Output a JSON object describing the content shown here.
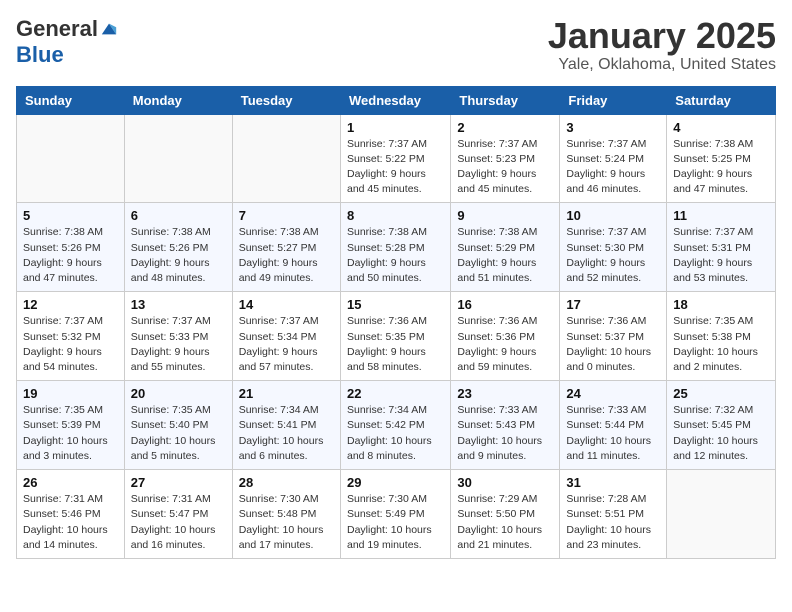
{
  "logo": {
    "general": "General",
    "blue": "Blue"
  },
  "title": "January 2025",
  "location": "Yale, Oklahoma, United States",
  "days_of_week": [
    "Sunday",
    "Monday",
    "Tuesday",
    "Wednesday",
    "Thursday",
    "Friday",
    "Saturday"
  ],
  "weeks": [
    [
      {
        "day": "",
        "info": ""
      },
      {
        "day": "",
        "info": ""
      },
      {
        "day": "",
        "info": ""
      },
      {
        "day": "1",
        "info": "Sunrise: 7:37 AM\nSunset: 5:22 PM\nDaylight: 9 hours\nand 45 minutes."
      },
      {
        "day": "2",
        "info": "Sunrise: 7:37 AM\nSunset: 5:23 PM\nDaylight: 9 hours\nand 45 minutes."
      },
      {
        "day": "3",
        "info": "Sunrise: 7:37 AM\nSunset: 5:24 PM\nDaylight: 9 hours\nand 46 minutes."
      },
      {
        "day": "4",
        "info": "Sunrise: 7:38 AM\nSunset: 5:25 PM\nDaylight: 9 hours\nand 47 minutes."
      }
    ],
    [
      {
        "day": "5",
        "info": "Sunrise: 7:38 AM\nSunset: 5:26 PM\nDaylight: 9 hours\nand 47 minutes."
      },
      {
        "day": "6",
        "info": "Sunrise: 7:38 AM\nSunset: 5:26 PM\nDaylight: 9 hours\nand 48 minutes."
      },
      {
        "day": "7",
        "info": "Sunrise: 7:38 AM\nSunset: 5:27 PM\nDaylight: 9 hours\nand 49 minutes."
      },
      {
        "day": "8",
        "info": "Sunrise: 7:38 AM\nSunset: 5:28 PM\nDaylight: 9 hours\nand 50 minutes."
      },
      {
        "day": "9",
        "info": "Sunrise: 7:38 AM\nSunset: 5:29 PM\nDaylight: 9 hours\nand 51 minutes."
      },
      {
        "day": "10",
        "info": "Sunrise: 7:37 AM\nSunset: 5:30 PM\nDaylight: 9 hours\nand 52 minutes."
      },
      {
        "day": "11",
        "info": "Sunrise: 7:37 AM\nSunset: 5:31 PM\nDaylight: 9 hours\nand 53 minutes."
      }
    ],
    [
      {
        "day": "12",
        "info": "Sunrise: 7:37 AM\nSunset: 5:32 PM\nDaylight: 9 hours\nand 54 minutes."
      },
      {
        "day": "13",
        "info": "Sunrise: 7:37 AM\nSunset: 5:33 PM\nDaylight: 9 hours\nand 55 minutes."
      },
      {
        "day": "14",
        "info": "Sunrise: 7:37 AM\nSunset: 5:34 PM\nDaylight: 9 hours\nand 57 minutes."
      },
      {
        "day": "15",
        "info": "Sunrise: 7:36 AM\nSunset: 5:35 PM\nDaylight: 9 hours\nand 58 minutes."
      },
      {
        "day": "16",
        "info": "Sunrise: 7:36 AM\nSunset: 5:36 PM\nDaylight: 9 hours\nand 59 minutes."
      },
      {
        "day": "17",
        "info": "Sunrise: 7:36 AM\nSunset: 5:37 PM\nDaylight: 10 hours\nand 0 minutes."
      },
      {
        "day": "18",
        "info": "Sunrise: 7:35 AM\nSunset: 5:38 PM\nDaylight: 10 hours\nand 2 minutes."
      }
    ],
    [
      {
        "day": "19",
        "info": "Sunrise: 7:35 AM\nSunset: 5:39 PM\nDaylight: 10 hours\nand 3 minutes."
      },
      {
        "day": "20",
        "info": "Sunrise: 7:35 AM\nSunset: 5:40 PM\nDaylight: 10 hours\nand 5 minutes."
      },
      {
        "day": "21",
        "info": "Sunrise: 7:34 AM\nSunset: 5:41 PM\nDaylight: 10 hours\nand 6 minutes."
      },
      {
        "day": "22",
        "info": "Sunrise: 7:34 AM\nSunset: 5:42 PM\nDaylight: 10 hours\nand 8 minutes."
      },
      {
        "day": "23",
        "info": "Sunrise: 7:33 AM\nSunset: 5:43 PM\nDaylight: 10 hours\nand 9 minutes."
      },
      {
        "day": "24",
        "info": "Sunrise: 7:33 AM\nSunset: 5:44 PM\nDaylight: 10 hours\nand 11 minutes."
      },
      {
        "day": "25",
        "info": "Sunrise: 7:32 AM\nSunset: 5:45 PM\nDaylight: 10 hours\nand 12 minutes."
      }
    ],
    [
      {
        "day": "26",
        "info": "Sunrise: 7:31 AM\nSunset: 5:46 PM\nDaylight: 10 hours\nand 14 minutes."
      },
      {
        "day": "27",
        "info": "Sunrise: 7:31 AM\nSunset: 5:47 PM\nDaylight: 10 hours\nand 16 minutes."
      },
      {
        "day": "28",
        "info": "Sunrise: 7:30 AM\nSunset: 5:48 PM\nDaylight: 10 hours\nand 17 minutes."
      },
      {
        "day": "29",
        "info": "Sunrise: 7:30 AM\nSunset: 5:49 PM\nDaylight: 10 hours\nand 19 minutes."
      },
      {
        "day": "30",
        "info": "Sunrise: 7:29 AM\nSunset: 5:50 PM\nDaylight: 10 hours\nand 21 minutes."
      },
      {
        "day": "31",
        "info": "Sunrise: 7:28 AM\nSunset: 5:51 PM\nDaylight: 10 hours\nand 23 minutes."
      },
      {
        "day": "",
        "info": ""
      }
    ]
  ]
}
